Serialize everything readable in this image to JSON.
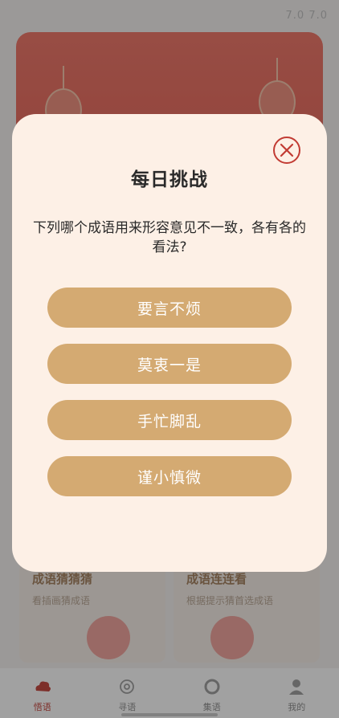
{
  "status": {
    "top_right_text": "7.0 7.0"
  },
  "cards": [
    {
      "title": "成语猜猜猜",
      "subtitle": "看插画猜成语"
    },
    {
      "title": "成语连连看",
      "subtitle": "根据提示猜首选成语"
    }
  ],
  "tabbar": [
    {
      "label": "悟语",
      "icon": "cloud-icon",
      "active": true
    },
    {
      "label": "寻语",
      "icon": "flower-icon",
      "active": false
    },
    {
      "label": "集语",
      "icon": "circle-icon",
      "active": false
    },
    {
      "label": "我的",
      "icon": "user-icon",
      "active": false
    }
  ],
  "modal": {
    "title": "每日挑战",
    "question": "下列哪个成语用来形容意见不一致，各有各的看法?",
    "options": [
      "要言不烦",
      "莫衷一是",
      "手忙脚乱",
      "谨小慎微"
    ],
    "close_icon": "close-circle-icon"
  },
  "colors": {
    "accent_red": "#c23b33",
    "option_gold": "#d4aa72",
    "modal_bg": "#fdf0e6"
  }
}
